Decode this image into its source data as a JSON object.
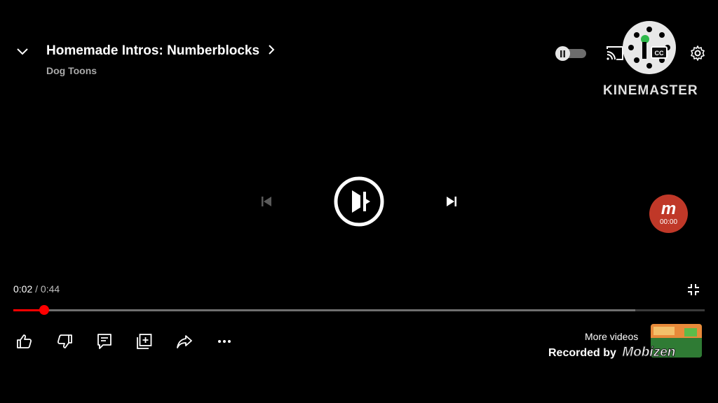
{
  "header": {
    "title": "Homemade Intros: Numberblocks",
    "channel": "Dog Toons",
    "collapse_icon": "chevron-down-icon",
    "title_chevron_icon": "chevron-right-icon"
  },
  "top_controls": {
    "autoplay_icon": "pause-toggle-icon",
    "cast_icon": "cast-icon",
    "captions_icon": "cc-icon",
    "settings_icon": "gear-icon"
  },
  "watermark": {
    "kinemaster_label": "KINEMASTER",
    "mobizen_timer": "00:00",
    "mobizen_mark": "m",
    "recorded_by": "Recorded by",
    "recorded_by_brand": "Mobizen"
  },
  "player": {
    "prev_icon": "skip-previous-icon",
    "play_icon": "play-pause-icon",
    "next_icon": "skip-next-icon",
    "current_time": "0:02",
    "separator": "/",
    "duration": "0:44",
    "progress_fraction": 0.045,
    "buffered_fraction": 0.9,
    "exit_fullscreen_icon": "exit-fullscreen-icon"
  },
  "actions": {
    "like_icon": "thumbs-up-icon",
    "dislike_icon": "thumbs-down-icon",
    "comments_icon": "comment-icon",
    "save_icon": "add-to-playlist-icon",
    "share_icon": "share-icon",
    "more_icon": "more-horizontal-icon",
    "more_videos_label": "More videos"
  },
  "colors": {
    "progress": "#ff0000",
    "mobizen_badge": "#c03828",
    "background": "#000000"
  }
}
